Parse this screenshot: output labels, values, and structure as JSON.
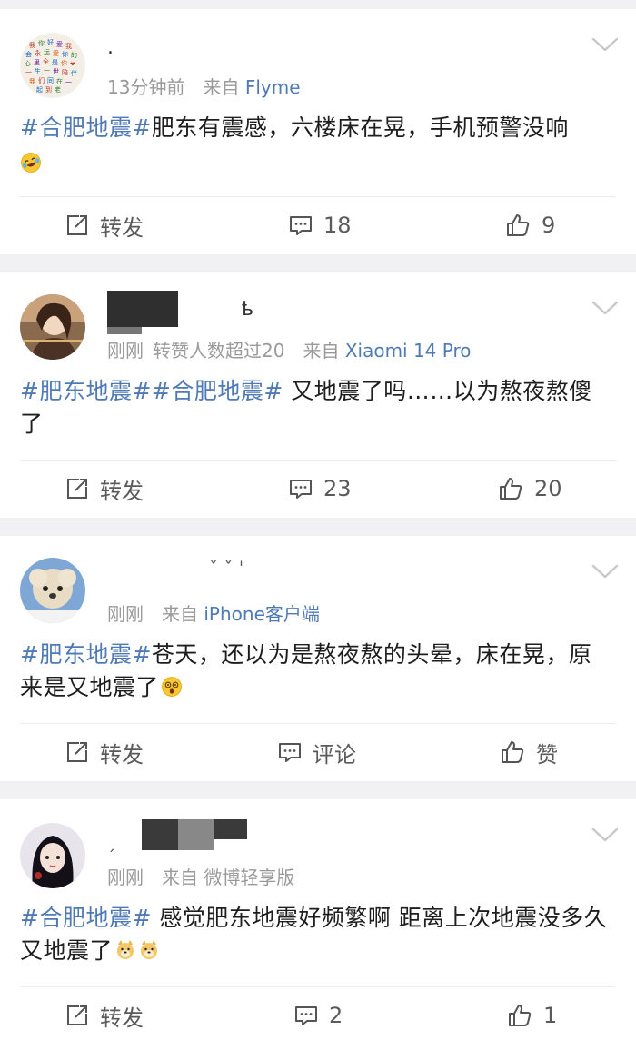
{
  "posts": [
    {
      "username": ".",
      "time": "13分钟前",
      "from_label": "来自",
      "source": "Flyme",
      "content": {
        "tags": [
          "#合肥地震#"
        ],
        "text": "肥东有震感，六楼床在晃，手机预警没响",
        "emoji": "laughing-tears-emoji"
      },
      "actions": {
        "repost": "转发",
        "comments": "18",
        "likes": "9"
      }
    },
    {
      "username": "",
      "time": "刚刚",
      "extra": "转赞人数超过20",
      "from_label": "来自",
      "source": "Xiaomi 14 Pro",
      "content": {
        "tags": [
          "#肥东地震#",
          "#合肥地震#"
        ],
        "text": " 又地震了吗……以为熬夜熬傻了"
      },
      "actions": {
        "repost": "转发",
        "comments": "23",
        "likes": "20"
      }
    },
    {
      "username": "",
      "time": "刚刚",
      "from_label": "来自",
      "source": "iPhone客户端",
      "content": {
        "tags": [
          "#肥东地震#"
        ],
        "text": "苍天，还以为是熬夜熬的头晕，床在晃，原来是又地震了",
        "emoji": "dizzy-face-emoji"
      },
      "actions": {
        "repost": "转发",
        "comments": "评论",
        "likes": "赞"
      }
    },
    {
      "username": "",
      "time": "刚刚",
      "from_label": "来自",
      "source": "微博轻享版",
      "content": {
        "tags": [
          "#合肥地震#"
        ],
        "text": " 感觉肥东地震好频繁啊 距离上次地震没多久又地震了",
        "emoji": "doge-emoji"
      },
      "actions": {
        "repost": "转发",
        "comments": "2",
        "likes": "1"
      }
    }
  ],
  "colors": {
    "link": "#4f7ab5",
    "meta": "#9a9a9a",
    "background": "#f1f1f3"
  }
}
